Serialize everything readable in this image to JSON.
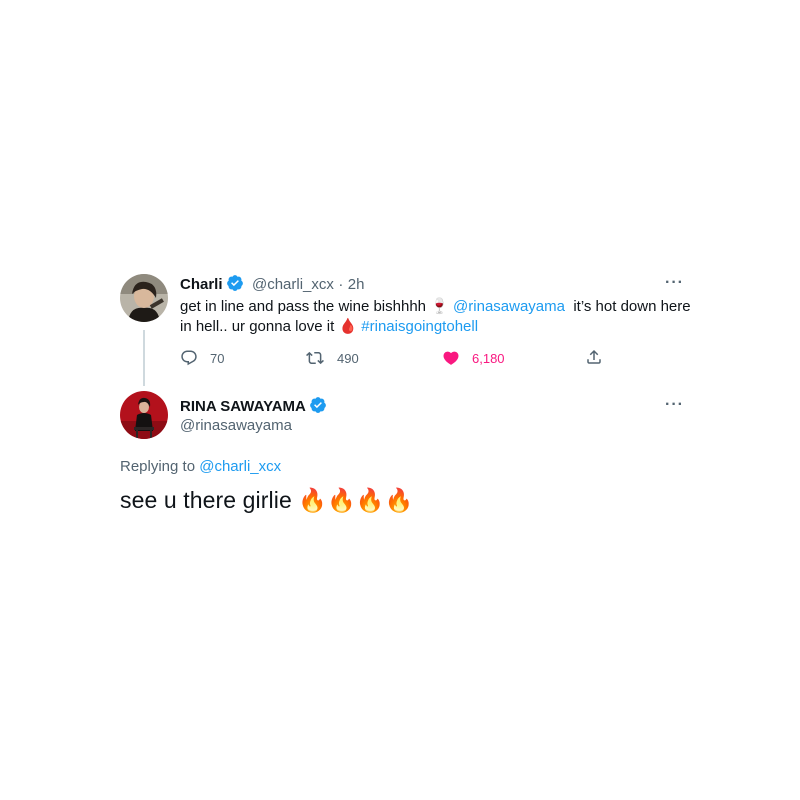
{
  "parent_tweet": {
    "author_name": "Charli",
    "author_handle": "@charli_xcx",
    "separator": "·",
    "timestamp": "2h",
    "more_label": "···",
    "text_part1": "get in line and pass the wine bishhhh ",
    "emoji_wine": "🍷",
    "mention": "@rinasawayama",
    "text_part2": "  it’s hot down here",
    "text_part3": "in hell.. ur gonna love it ",
    "emoji_blood": "🩸",
    "hashtag": "#rinaisgoingtohell",
    "reply_count": "70",
    "retweet_count": "490",
    "like_count": "6,180"
  },
  "reply_tweet": {
    "author_name": "RINA SAWAYAMA",
    "author_handle": "@rinasawayama",
    "more_label": "···",
    "replying_to_label": "Replying to ",
    "replying_to_handle": "@charli_xcx",
    "text": "see u there girlie",
    "fire_emojis": [
      "🔥",
      "🔥",
      "🔥",
      "🔥"
    ]
  },
  "colors": {
    "link_blue": "#1d9bf0",
    "like_pink": "#f91880",
    "muted_gray": "#536471",
    "verified_blue": "#1d9bf0"
  },
  "icons": [
    "reply-icon",
    "retweet-icon",
    "heart-icon",
    "share-icon",
    "verified-badge-icon",
    "more-options-icon"
  ]
}
